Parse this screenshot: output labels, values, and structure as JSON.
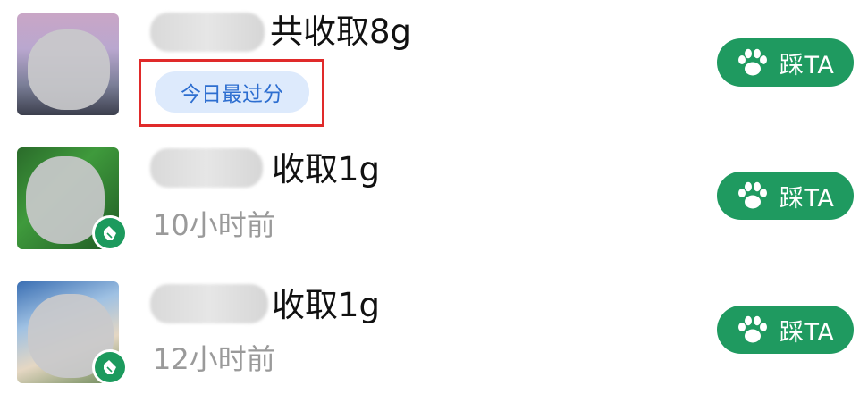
{
  "friends": [
    {
      "title": "共收取8g",
      "tag": "今日最过分",
      "time": "",
      "button_label": "踩TA",
      "has_helper_badge": false
    },
    {
      "title": "收取1g",
      "tag": "",
      "time": "10小时前",
      "button_label": "踩TA",
      "has_helper_badge": true
    },
    {
      "title": "收取1g",
      "tag": "",
      "time": "12小时前",
      "button_label": "踩TA",
      "has_helper_badge": true
    }
  ],
  "colors": {
    "button_bg": "#1f9a60",
    "tag_bg": "#ddeafc",
    "tag_text": "#2d6ed0",
    "highlight_border": "#e02a2a",
    "time_text": "#9a9a9a"
  },
  "icons": {
    "button_icon": "paw-icon",
    "helper_badge_icon": "glove-icon"
  }
}
